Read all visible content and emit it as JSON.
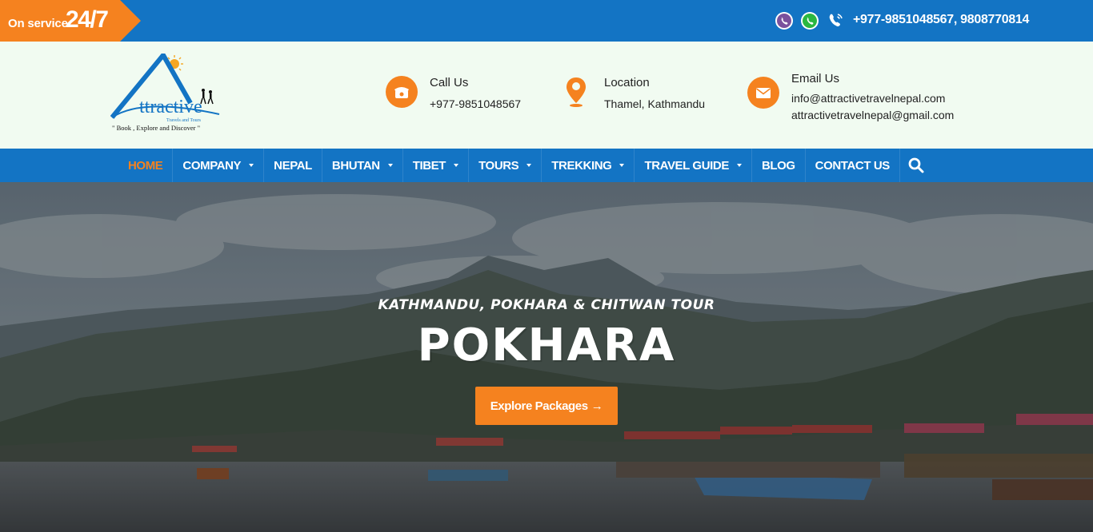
{
  "topbar": {
    "service_text": "On service",
    "service_hours": "24/7",
    "phones": "+977-9851048567, 9808770814",
    "icons": [
      "viber-icon",
      "whatsapp-icon",
      "phone-icon"
    ]
  },
  "logo": {
    "wordmark": "ttractive",
    "subtitle": "Travels and Tours",
    "tagline": "\" Book , Explore and Discover \""
  },
  "contacts": {
    "call": {
      "title": "Call Us",
      "value": "+977-9851048567"
    },
    "location": {
      "title": "Location",
      "value": "Thamel, Kathmandu"
    },
    "email": {
      "title": "Email Us",
      "value1": "info@attractivetravelnepal.com",
      "value2": "attractivetravelnepal@gmail.com"
    }
  },
  "nav": {
    "items": [
      {
        "label": "HOME",
        "active": true,
        "dropdown": false
      },
      {
        "label": "COMPANY",
        "dropdown": true
      },
      {
        "label": "NEPAL",
        "dropdown": false
      },
      {
        "label": "BHUTAN",
        "dropdown": true
      },
      {
        "label": "TIBET",
        "dropdown": true
      },
      {
        "label": "TOURS",
        "dropdown": true
      },
      {
        "label": "TREKKING",
        "dropdown": true
      },
      {
        "label": "TRAVEL GUIDE",
        "dropdown": true
      },
      {
        "label": "BLOG",
        "dropdown": false
      },
      {
        "label": "CONTACT US",
        "dropdown": false
      }
    ]
  },
  "hero": {
    "subtitle": "KATHMANDU, POKHARA & CHITWAN TOUR",
    "title": "POKHARA",
    "button_label": "Explore Packages",
    "button_arrow": "→"
  },
  "colors": {
    "primary_blue": "#1374c4",
    "accent_orange": "#f5821f",
    "header_bg": "#f1fbf1"
  }
}
